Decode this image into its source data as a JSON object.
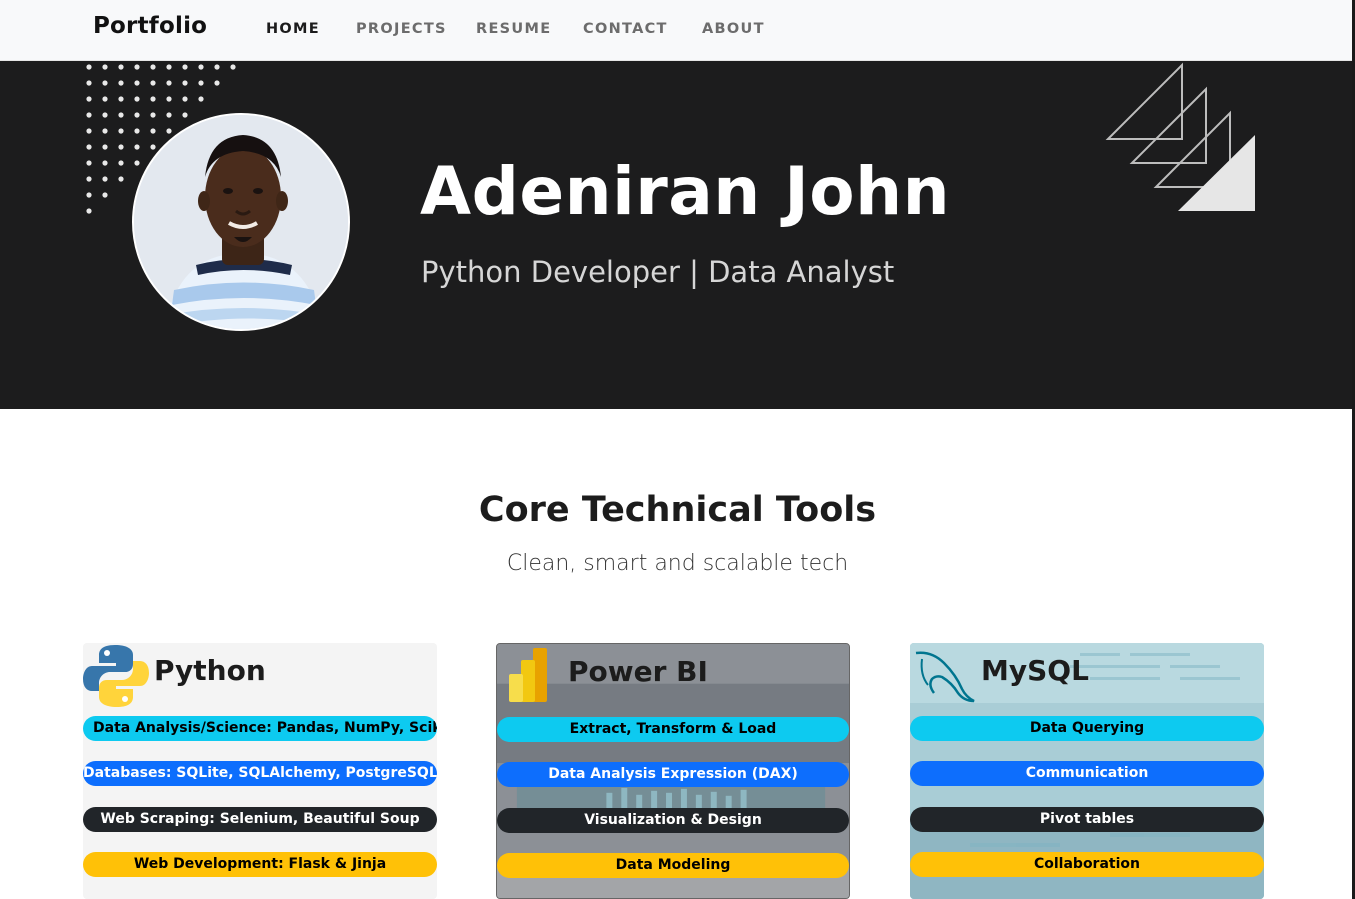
{
  "navbar": {
    "brand": "Portfolio",
    "links": [
      {
        "label": "HOME",
        "active": true
      },
      {
        "label": "PROJECTS",
        "active": false
      },
      {
        "label": "RESUME",
        "active": false
      },
      {
        "label": "CONTACT",
        "active": false
      },
      {
        "label": "ABOUT",
        "active": false
      }
    ]
  },
  "hero": {
    "name": "Adeniran John",
    "subtitle": "Python Developer | Data Analyst"
  },
  "tools": {
    "title": "Core Technical Tools",
    "subtitle": "Clean, smart and scalable tech",
    "cards": [
      {
        "icon": "python-logo-icon",
        "title": "Python",
        "skills": [
          "Data Analysis/Science: Pandas, NumPy, Scikit-Learn",
          "Databases: SQLite, SQLAlchemy, PostgreSQL",
          "Web Scraping: Selenium, Beautiful Soup",
          "Web Development: Flask & Jinja"
        ]
      },
      {
        "icon": "power-bi-logo-icon",
        "title": "Power BI",
        "skills": [
          "Extract, Transform & Load",
          "Data Analysis Expression (DAX)",
          "Visualization & Design",
          "Data Modeling"
        ]
      },
      {
        "icon": "mysql-dolphin-icon",
        "title": "MySQL",
        "skills": [
          "Data Querying",
          "Communication",
          "Pivot tables",
          "Collaboration"
        ]
      }
    ]
  },
  "colors": {
    "hero_bg": "#1c1c1d",
    "pill_cyan": "#0dcaf0",
    "pill_blue": "#0d6efd",
    "pill_dark": "#212529",
    "pill_yellow": "#ffc107"
  }
}
